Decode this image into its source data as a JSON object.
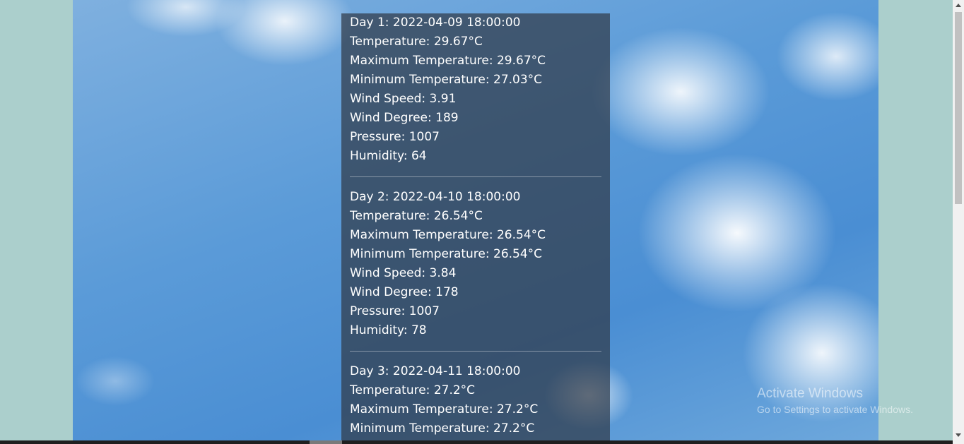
{
  "forecast": {
    "days": [
      {
        "header": "Day 1: 2022-04-09 18:00:00",
        "temperature": "Temperature: 29.67°C",
        "max_temp": "Maximum Temperature: 29.67°C",
        "min_temp": "Minimum Temperature: 27.03°C",
        "wind_speed": "Wind Speed: 3.91",
        "wind_degree": "Wind Degree: 189",
        "pressure": "Pressure: 1007",
        "humidity": "Humidity: 64"
      },
      {
        "header": "Day 2: 2022-04-10 18:00:00",
        "temperature": "Temperature: 26.54°C",
        "max_temp": "Maximum Temperature: 26.54°C",
        "min_temp": "Minimum Temperature: 26.54°C",
        "wind_speed": "Wind Speed: 3.84",
        "wind_degree": "Wind Degree: 178",
        "pressure": "Pressure: 1007",
        "humidity": "Humidity: 78"
      },
      {
        "header": "Day 3: 2022-04-11 18:00:00",
        "temperature": "Temperature: 27.2°C",
        "max_temp": "Maximum Temperature: 27.2°C",
        "min_temp": "Minimum Temperature: 27.2°C"
      }
    ]
  },
  "watermark": {
    "title": "Activate Windows",
    "subtitle": "Go to Settings to activate Windows."
  },
  "colors": {
    "page_background": "#abcfcc",
    "panel_background": "#303a48"
  }
}
